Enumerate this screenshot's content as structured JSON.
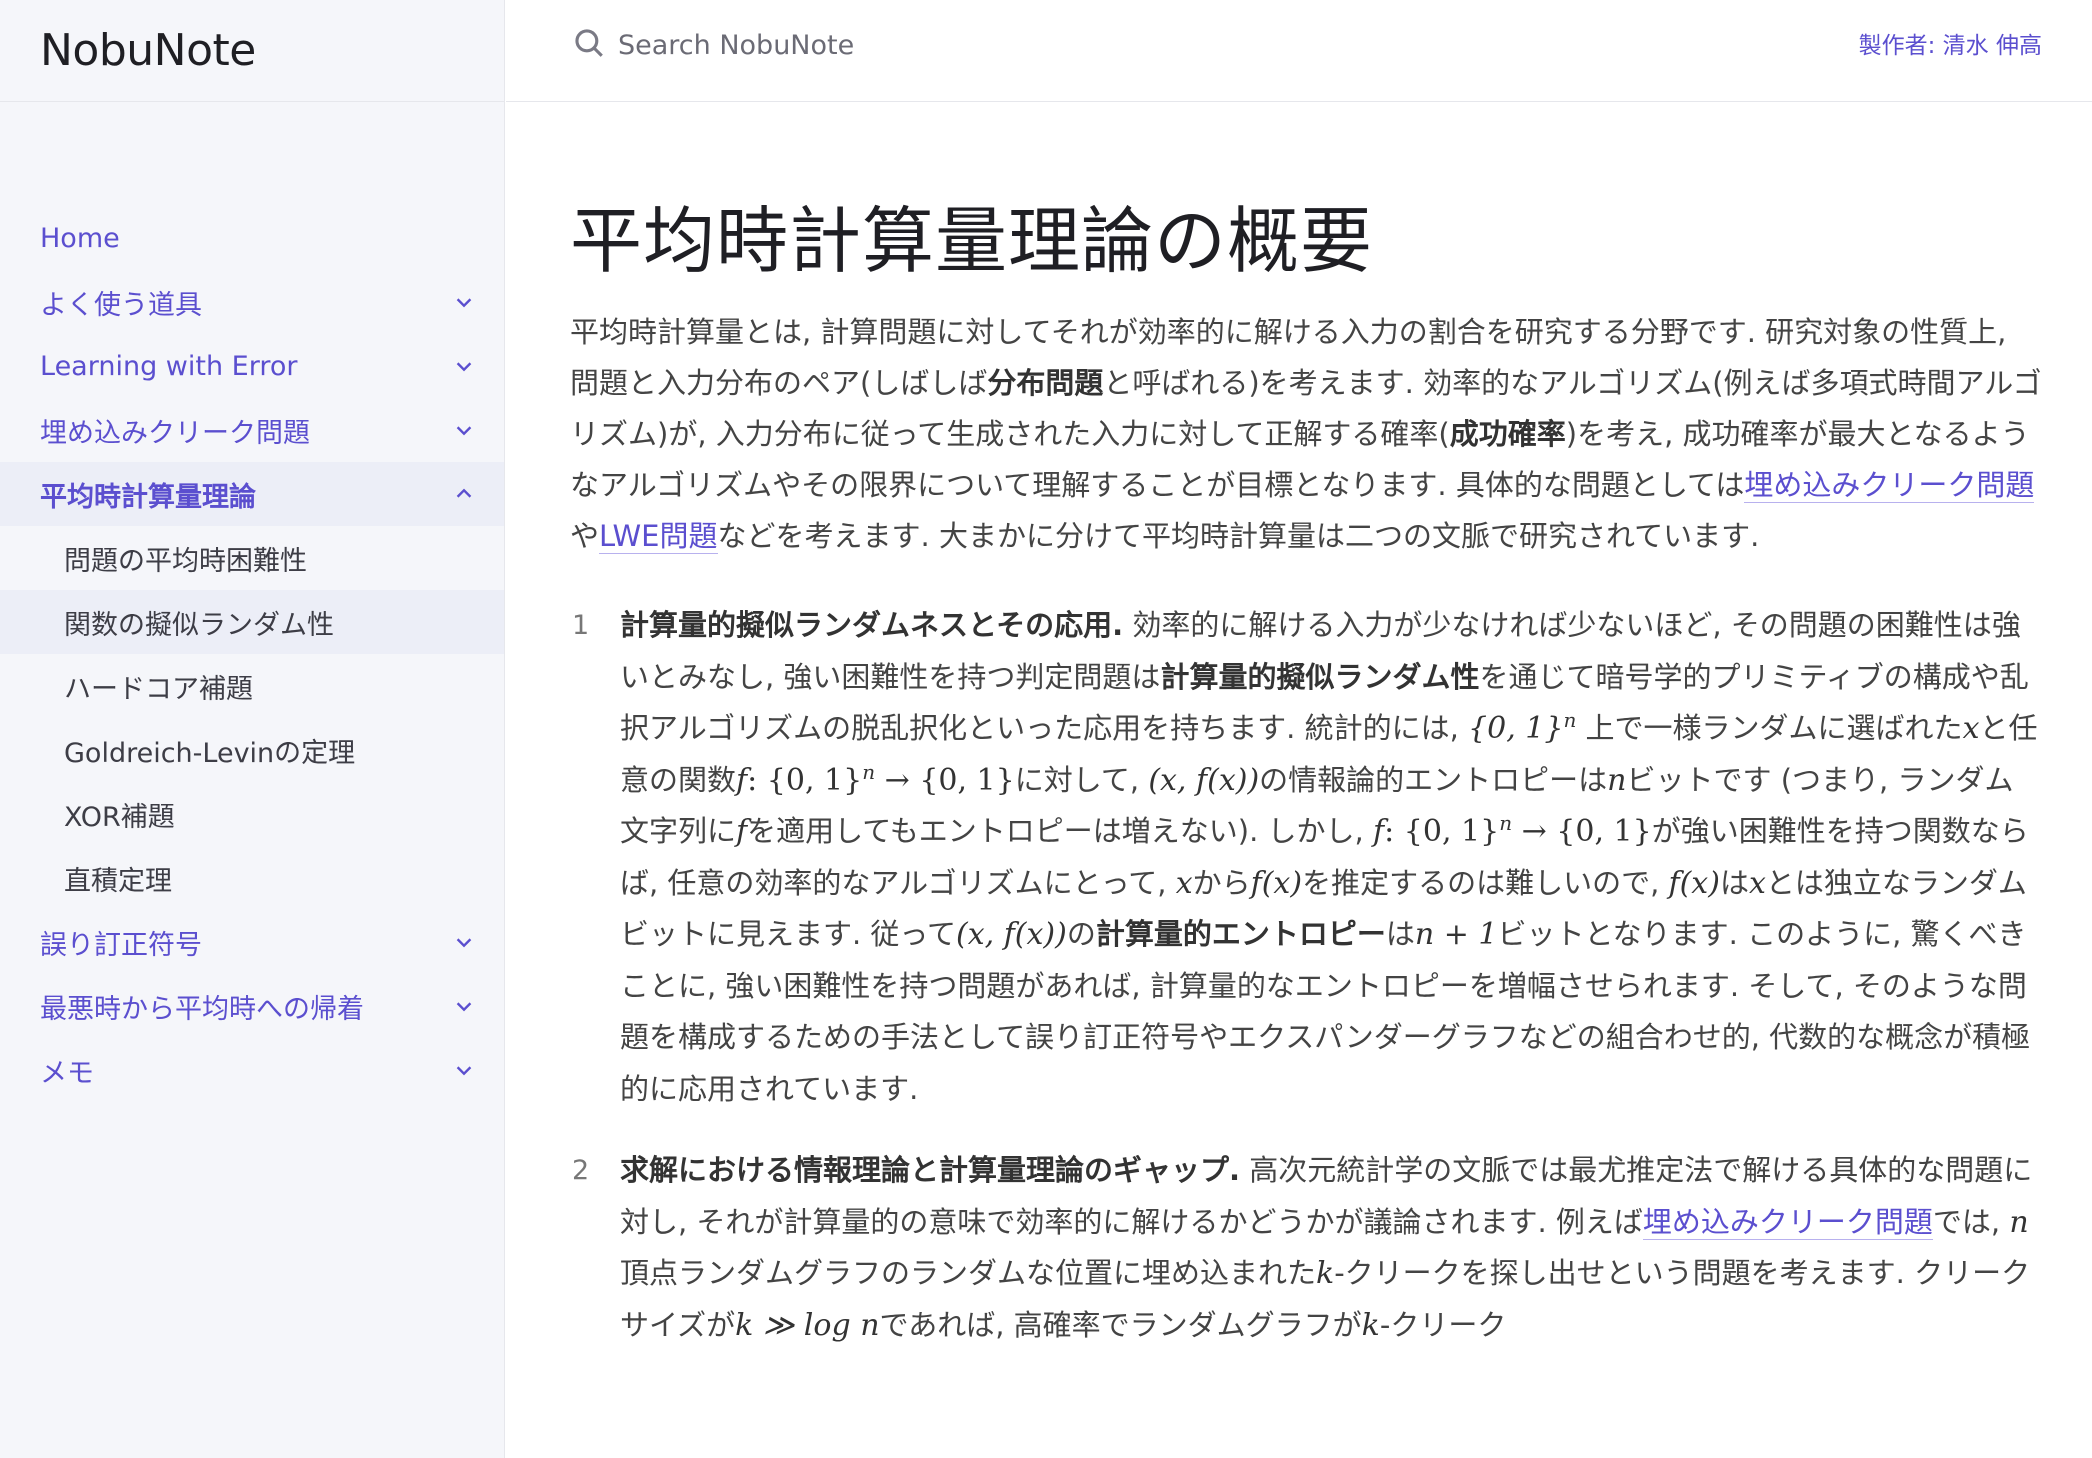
{
  "brand": "NobuNote",
  "search": {
    "placeholder": "Search NobuNote"
  },
  "author": "製作者: 清水 伸高",
  "nav": {
    "home": "Home",
    "tools": "よく使う道具",
    "lwe": "Learning with Error",
    "planted_clique": "埋め込みクリーク問題",
    "avg_case": "平均時計算量理論",
    "sub": [
      "問題の平均時困難性",
      "関数の擬似ランダム性",
      "ハードコア補題",
      "Goldreich-Levinの定理",
      "XOR補題",
      "直積定理"
    ],
    "ecc": "誤り訂正符号",
    "worst_to_avg": "最悪時から平均時への帰着",
    "memo": "メモ"
  },
  "content": {
    "title": "平均時計算量理論の概要",
    "lead": {
      "t1": "平均時計算量とは, 計算問題に対してそれが効率的に解ける入力の割合を研究する分野です. 研究対象の性質上, 問題と入力分布のペア(しばしば",
      "b1": "分布問題",
      "t2": "と呼ばれる)を考えます. 効率的なアルゴリズム(例えば多項式時間アルゴリズム)が, 入力分布に従って生成された入力に対して正解する確率(",
      "b2": "成功確率",
      "t3": ")を考え, 成功確率が最大となるようなアルゴリズムやその限界について理解することが目標となります. 具体的な問題としては",
      "link1": "埋め込みクリーク問題",
      "t4": "や",
      "link2": "LWE問題",
      "t5": "などを考えます. 大まかに分けて平均時計算量は二つの文脈で研究されています."
    },
    "item1": {
      "num": "1",
      "head": "計算量的擬似ランダムネスとその応用.",
      "t1": " 効率的に解ける入力が少なければ少ないほど, その問題の困難性は強いとみなし, 強い困難性を持つ判定問題は",
      "b1": "計算量的擬似ランダム性",
      "t2": "を通じて暗号学的プリミティブの構成や乱択アルゴリズムの脱乱択化といった応用を持ちます. 統計的には, ",
      "m1": "{0, 1}",
      "t3": " 上で一様ランダムに選ばれた",
      "t4": "と任意の関数",
      "m2": "{0, 1}",
      "m2b": "→ {0, 1}",
      "t5": "に対して, ",
      "m3": "(x, f(x))",
      "t6": "の情報論的エントロピーは",
      "t7": "ビットです (つまり, ランダム文字列に",
      "t8": "を適用してもエントロピーは増えない). しかし, ",
      "t9": "が強い困難性を持つ関数ならば, 任意の効率的なアルゴリズムにとって, ",
      "t10": "から",
      "m4": "f(x)",
      "t11": "を推定するのは難しいので, ",
      "t12": "は",
      "t13": "とは独立なランダムビットに見えます. 従って",
      "t14": "の",
      "b2": "計算量的エントロピー",
      "t15": "は",
      "m5": "n + 1",
      "t16": "ビットとなります. このように, 驚くべきことに, 強い困難性を持つ問題があれば, 計算量的なエントロピーを増幅させられます. そして, そのような問題を構成するための手法として誤り訂正符号やエクスパンダーグラフなどの組合わせ的, 代数的な概念が積極的に応用されています."
    },
    "item2": {
      "num": "2",
      "head": "求解における情報理論と計算量理論のギャップ.",
      "t1": " 高次元統計学の文脈では最尤推定法で解ける具体的な問題に対し, それが計算量的の意味で効率的に解けるかどうかが議論されます. 例えば",
      "link1": "埋め込みクリーク問題",
      "t2": "では, ",
      "t3": "頂点ランダムグラフのランダムな位置に埋め込まれた",
      "t4": "-クリークを探し出せという問題を考えます. クリークサイズが",
      "m1": "k ≫ log n",
      "t5": "であれば, 高確率でランダムグラフが",
      "t6": "-クリーク"
    },
    "vars": {
      "x": "x",
      "f": "f",
      "n": "n",
      "k": "k",
      "sup_n": "n",
      "colon": ":"
    }
  }
}
